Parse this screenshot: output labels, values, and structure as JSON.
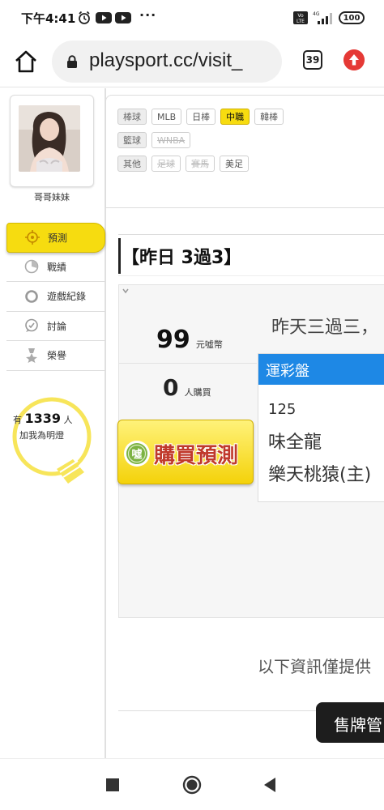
{
  "status_bar": {
    "time": "下午4:41",
    "dots": "···",
    "signal": "4G",
    "battery": "100"
  },
  "browser": {
    "url": "playsport.cc/visit_",
    "tab_count": "39"
  },
  "sidebar": {
    "username": "哥哥妹妹",
    "nav": [
      {
        "label": "預測",
        "icon": "crosshair-icon",
        "active": true
      },
      {
        "label": "戰績",
        "icon": "chart-icon",
        "active": false
      },
      {
        "label": "遊戲紀錄",
        "icon": "ring-icon",
        "active": false
      },
      {
        "label": "討論",
        "icon": "chat-icon",
        "active": false
      },
      {
        "label": "榮譽",
        "icon": "medal-icon",
        "active": false
      }
    ],
    "bulb": {
      "prefix": "有",
      "count": "1339",
      "suffix": "人",
      "caption": "加我為明燈"
    }
  },
  "filters": {
    "rows": [
      {
        "label": "棒球",
        "chips": [
          {
            "text": "MLB",
            "state": "normal"
          },
          {
            "text": "日棒",
            "state": "normal"
          },
          {
            "text": "中職",
            "state": "active"
          },
          {
            "text": "韓棒",
            "state": "normal"
          }
        ]
      },
      {
        "label": "籃球",
        "chips": [
          {
            "text": "WNBA",
            "state": "disabled"
          }
        ]
      },
      {
        "label": "其他",
        "chips": [
          {
            "text": "足球",
            "state": "disabled"
          },
          {
            "text": "賽馬",
            "state": "disabled"
          },
          {
            "text": "美足",
            "state": "normal"
          }
        ]
      }
    ]
  },
  "headline": "【昨日 3過3】",
  "prediction": {
    "price": "99",
    "price_unit": "元噓幣",
    "buyers": "0",
    "buyers_unit": "人購買",
    "buy_button": "購買預測",
    "coin_label": "噓",
    "yesterday_text": "昨天三過三，"
  },
  "lottery": {
    "header": "運彩盤",
    "code": "125",
    "team1": "味全龍",
    "team2": "樂天桃猿(主)"
  },
  "disclaimer": "以下資訊僅提供",
  "sell_button": "售牌管",
  "colors": {
    "accent_yellow": "#f6dc10",
    "lottery_blue": "#1e88e5",
    "buy_text_red": "#c0392b"
  }
}
